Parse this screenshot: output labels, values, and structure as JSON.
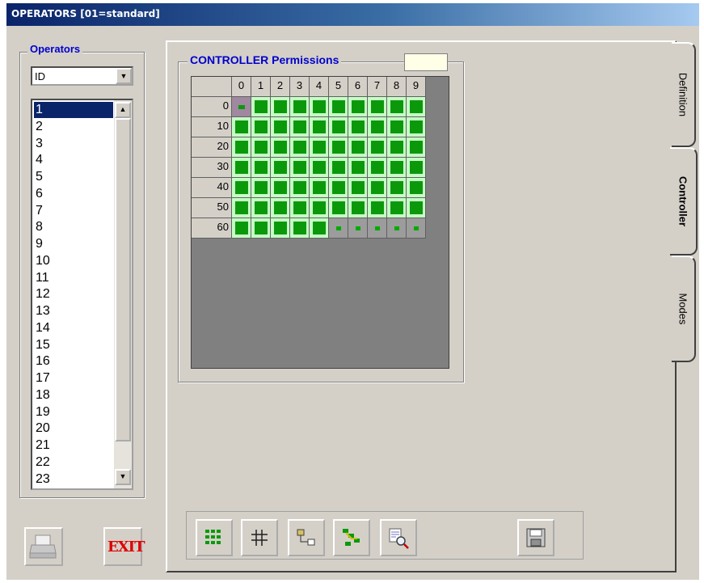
{
  "window": {
    "title": "OPERATORS [01=standard]"
  },
  "operators_panel": {
    "group_label": "Operators",
    "sort_combo": {
      "value": "ID"
    },
    "selected_item": "1",
    "items": [
      "1",
      "2",
      "3",
      "4",
      "5",
      "6",
      "7",
      "8",
      "9",
      "10",
      "11",
      "12",
      "13",
      "14",
      "15",
      "16",
      "17",
      "18",
      "19",
      "20",
      "21",
      "22",
      "23"
    ]
  },
  "left_buttons": {
    "print_icon": "printer-icon",
    "exit_label": "EXIT"
  },
  "tabs": [
    {
      "label": "Definition",
      "active": false
    },
    {
      "label": "Controller",
      "active": true
    },
    {
      "label": "Modes",
      "active": false
    }
  ],
  "permissions": {
    "group_label": "CONTROLLER Permissions",
    "field_value": "",
    "column_headers": [
      "0",
      "1",
      "2",
      "3",
      "4",
      "5",
      "6",
      "7",
      "8",
      "9"
    ],
    "row_headers": [
      "0",
      "10",
      "20",
      "30",
      "40",
      "50",
      "60"
    ],
    "cells": [
      [
        "selected",
        "on",
        "on",
        "on",
        "on",
        "on",
        "on",
        "on",
        "on",
        "on"
      ],
      [
        "on",
        "on",
        "on",
        "on",
        "on",
        "on",
        "on",
        "on",
        "on",
        "on"
      ],
      [
        "on",
        "on",
        "on",
        "on",
        "on",
        "on",
        "on",
        "on",
        "on",
        "on"
      ],
      [
        "on",
        "on",
        "on",
        "on",
        "on",
        "on",
        "on",
        "on",
        "on",
        "on"
      ],
      [
        "on",
        "on",
        "on",
        "on",
        "on",
        "on",
        "on",
        "on",
        "on",
        "on"
      ],
      [
        "on",
        "on",
        "on",
        "on",
        "on",
        "on",
        "on",
        "on",
        "on",
        "on"
      ],
      [
        "on",
        "on",
        "on",
        "on",
        "on",
        "off",
        "off",
        "off",
        "off",
        "off"
      ]
    ],
    "colors": {
      "granted": "#0b990b",
      "cell_bg": "#c6ffc6",
      "unavailable": "#9c9c9c",
      "grid_bg": "#808080"
    }
  },
  "toolbar": {
    "buttons": [
      "select-all-icon",
      "grid-icon",
      "copy-icon",
      "tree-icon",
      "zoom-report-icon",
      "save-icon"
    ]
  }
}
